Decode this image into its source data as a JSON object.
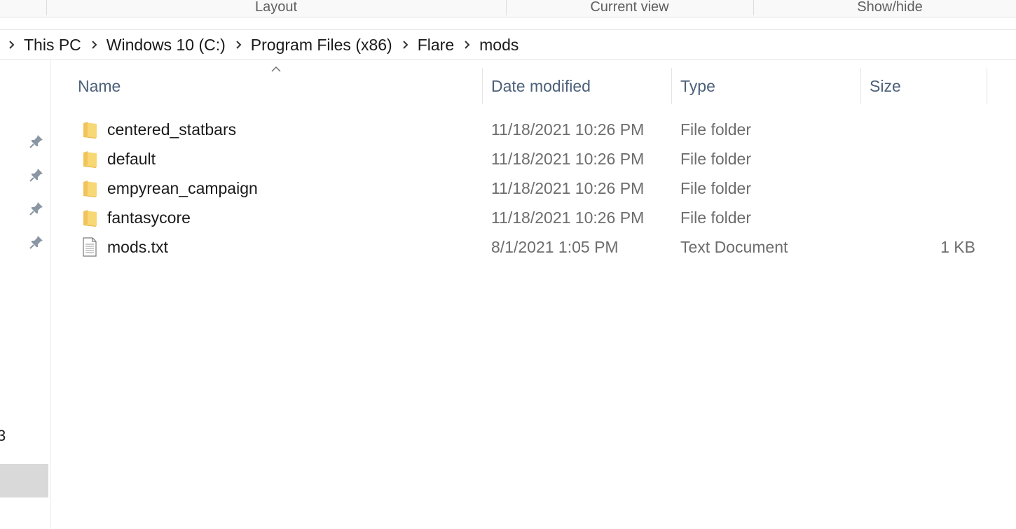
{
  "ribbon": {
    "groups": [
      "Layout",
      "Current view",
      "Show/hide"
    ]
  },
  "breadcrumb": [
    "This PC",
    "Windows 10 (C:)",
    "Program Files (x86)",
    "Flare",
    "mods"
  ],
  "navpane": {
    "partial_label": "3"
  },
  "columns": {
    "name": "Name",
    "date": "Date modified",
    "type": "Type",
    "size": "Size"
  },
  "files": [
    {
      "name": "centered_statbars",
      "date": "11/18/2021 10:26 PM",
      "type": "File folder",
      "size": "",
      "icon": "folder-icon"
    },
    {
      "name": "default",
      "date": "11/18/2021 10:26 PM",
      "type": "File folder",
      "size": "",
      "icon": "folder-icon"
    },
    {
      "name": "empyrean_campaign",
      "date": "11/18/2021 10:26 PM",
      "type": "File folder",
      "size": "",
      "icon": "folder-icon"
    },
    {
      "name": "fantasycore",
      "date": "11/18/2021 10:26 PM",
      "type": "File folder",
      "size": "",
      "icon": "folder-icon"
    },
    {
      "name": "mods.txt",
      "date": "8/1/2021 1:05 PM",
      "type": "Text Document",
      "size": "1 KB",
      "icon": "text-document-icon"
    }
  ],
  "colors": {
    "folder": "#f8d775",
    "folder_dark": "#e8b84a",
    "header_text": "#4c607a",
    "selected_nav": "#d9d9d9"
  }
}
